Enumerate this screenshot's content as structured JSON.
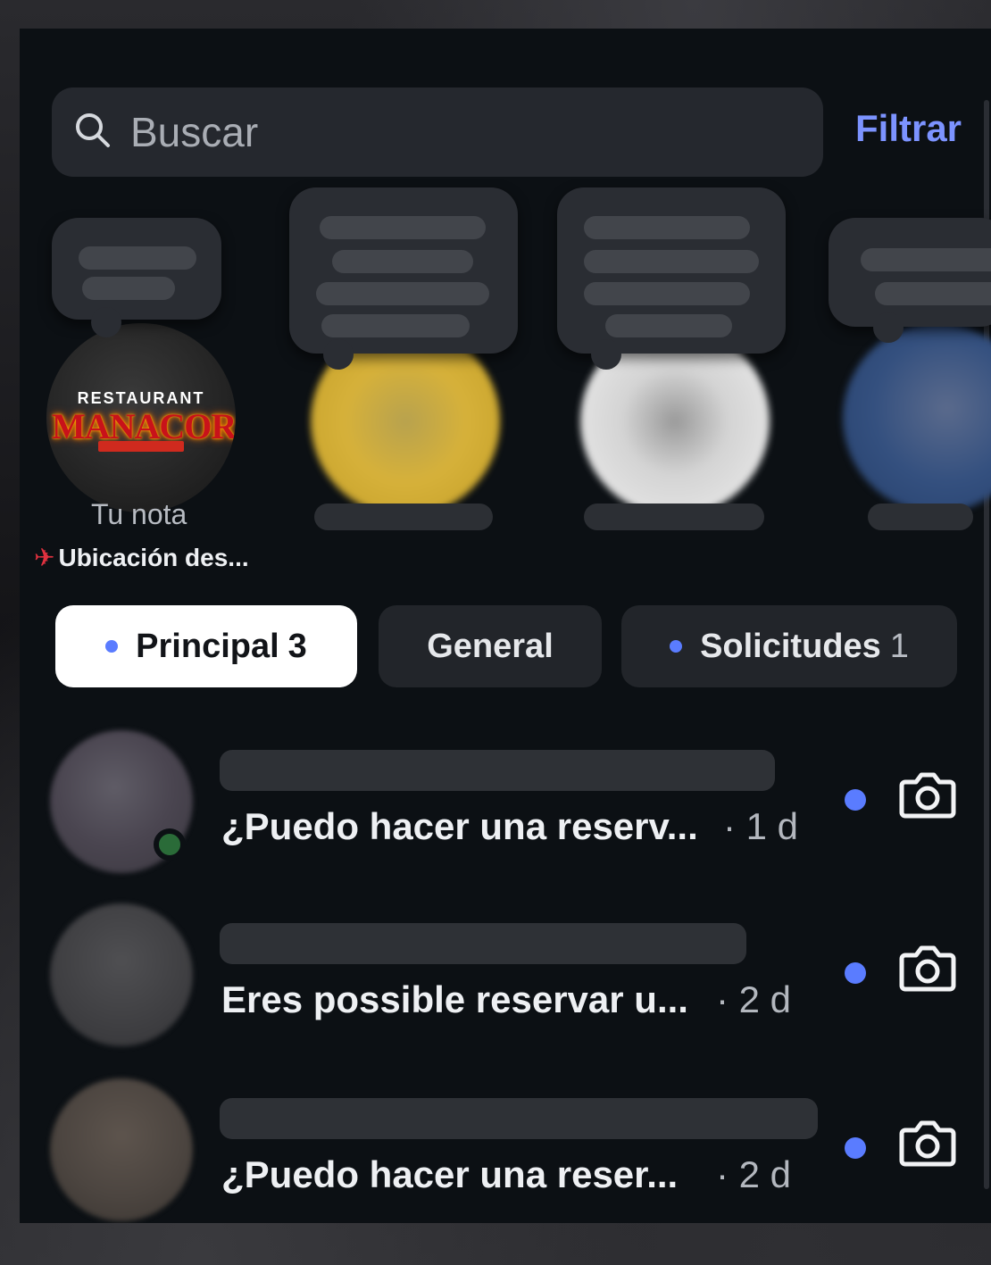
{
  "search": {
    "placeholder": "Buscar",
    "icon": "search-icon"
  },
  "header": {
    "filter_label": "Filtrar"
  },
  "notes": {
    "own": {
      "label": "Tu nota",
      "location": "Ubicación des...",
      "location_icon": "pin-icon"
    },
    "logo": {
      "top_text": "RESTAURANT",
      "main_text": "MANACOR"
    }
  },
  "tabs": [
    {
      "label": "Principal",
      "count": "3",
      "active": true,
      "dot": true
    },
    {
      "label": "General",
      "count": "",
      "active": false,
      "dot": false
    },
    {
      "label": "Solicitudes",
      "count": "1",
      "active": false,
      "dot": true
    }
  ],
  "messages": [
    {
      "preview": "¿Puedo hacer una reserv...",
      "time": "· 1 d",
      "unread": true,
      "online": true,
      "action_icon": "camera-icon"
    },
    {
      "preview": "Eres possible reservar u...",
      "time": "· 2 d",
      "unread": true,
      "online": false,
      "action_icon": "camera-icon"
    },
    {
      "preview": "¿Puedo hacer una reser...",
      "time": "· 2 d",
      "unread": true,
      "online": false,
      "action_icon": "camera-icon"
    }
  ],
  "colors": {
    "accent": "#7c93ff",
    "unread_dot": "#5a7cff",
    "panel": "#0c1014",
    "online": "#2a6b38"
  }
}
